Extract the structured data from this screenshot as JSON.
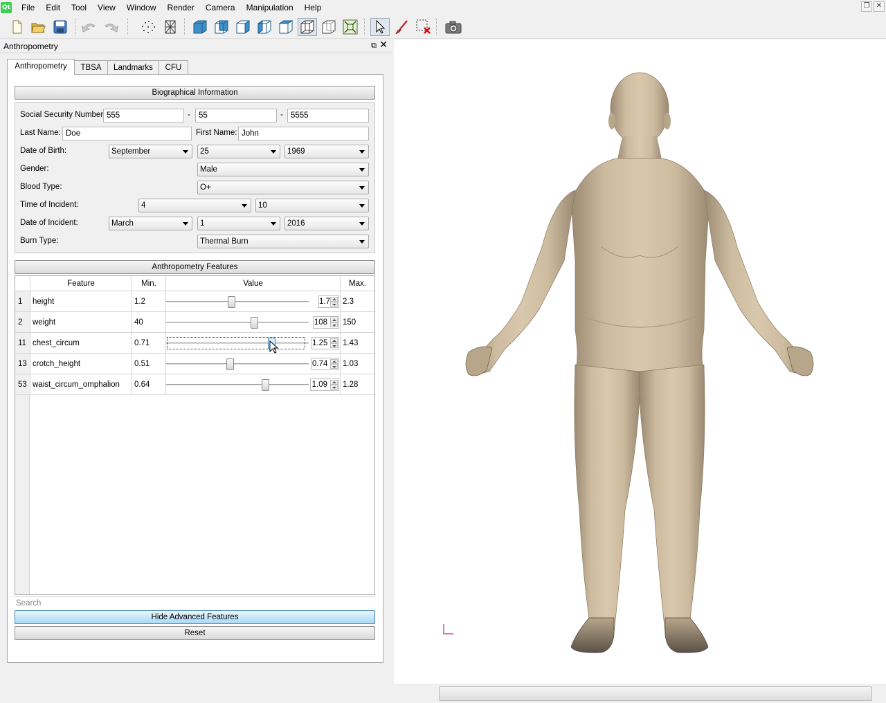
{
  "menu": [
    "File",
    "Edit",
    "Tool",
    "View",
    "Window",
    "Render",
    "Camera",
    "Manipulation",
    "Help"
  ],
  "toolbar_icons": [
    "new-file-icon",
    "open-folder-icon",
    "save-disk-icon",
    "undo-icon",
    "redo-icon",
    "point-cloud-icon",
    "wireframe-mesh-icon",
    "cube-view-front-icon",
    "cube-view-side-icon",
    "cube-view-top-icon",
    "cube-view-left-icon",
    "cube-view-right-icon",
    "cube-view-back-icon",
    "cube-view-iso-icon",
    "fit-view-icon",
    "select-arrow-icon",
    "paint-brush-icon",
    "clear-selection-icon",
    "camera-snapshot-icon"
  ],
  "dock": {
    "title": "Anthropometry"
  },
  "tabs": [
    "Anthropometry",
    "TBSA",
    "Landmarks",
    "CFU"
  ],
  "bio": {
    "header": "Biographical Information",
    "ssn_label": "Social Security Number:",
    "ssn": [
      "555",
      "55",
      "5555"
    ],
    "dash": "-",
    "last_name_label": "Last Name:",
    "last_name": "Doe",
    "first_name_label": "First Name:",
    "first_name": "John",
    "dob_label": "Date of Birth:",
    "dob": [
      "September",
      "25",
      "1969"
    ],
    "gender_label": "Gender:",
    "gender": "Male",
    "blood_label": "Blood Type:",
    "blood": "O+",
    "time_label": "Time of Incident:",
    "time": [
      "4",
      "10"
    ],
    "doi_label": "Date of Incident:",
    "doi": [
      "March",
      "1",
      "2016"
    ],
    "burn_label": "Burn Type:",
    "burn": "Thermal Burn"
  },
  "features": {
    "header": "Anthropometry Features",
    "columns": [
      "Feature",
      "Min.",
      "Value",
      "Max."
    ],
    "rows": [
      {
        "id": "1",
        "name": "height",
        "min": "1.2",
        "value": "1.7",
        "max": "2.3",
        "fraction": 0.45
      },
      {
        "id": "2",
        "name": "weight",
        "min": "40",
        "value": "108",
        "max": "150",
        "fraction": 0.62
      },
      {
        "id": "11",
        "name": "chest_circum",
        "min": "0.71",
        "value": "1.25",
        "max": "1.43",
        "fraction": 0.75
      },
      {
        "id": "13",
        "name": "crotch_height",
        "min": "0.51",
        "value": "0.74",
        "max": "1.03",
        "fraction": 0.44
      },
      {
        "id": "53",
        "name": "waist_circum_omphalion",
        "min": "0.64",
        "value": "1.09",
        "max": "1.28",
        "fraction": 0.7
      }
    ]
  },
  "search": {
    "placeholder": "Search"
  },
  "buttons": {
    "hide": "Hide Advanced Features",
    "reset": "Reset"
  },
  "colors": {
    "body_skin": "#cdbb9f",
    "accent": "#3c7fb1",
    "axis_red": "#d03040",
    "axis_purple": "#8a5cc8"
  }
}
